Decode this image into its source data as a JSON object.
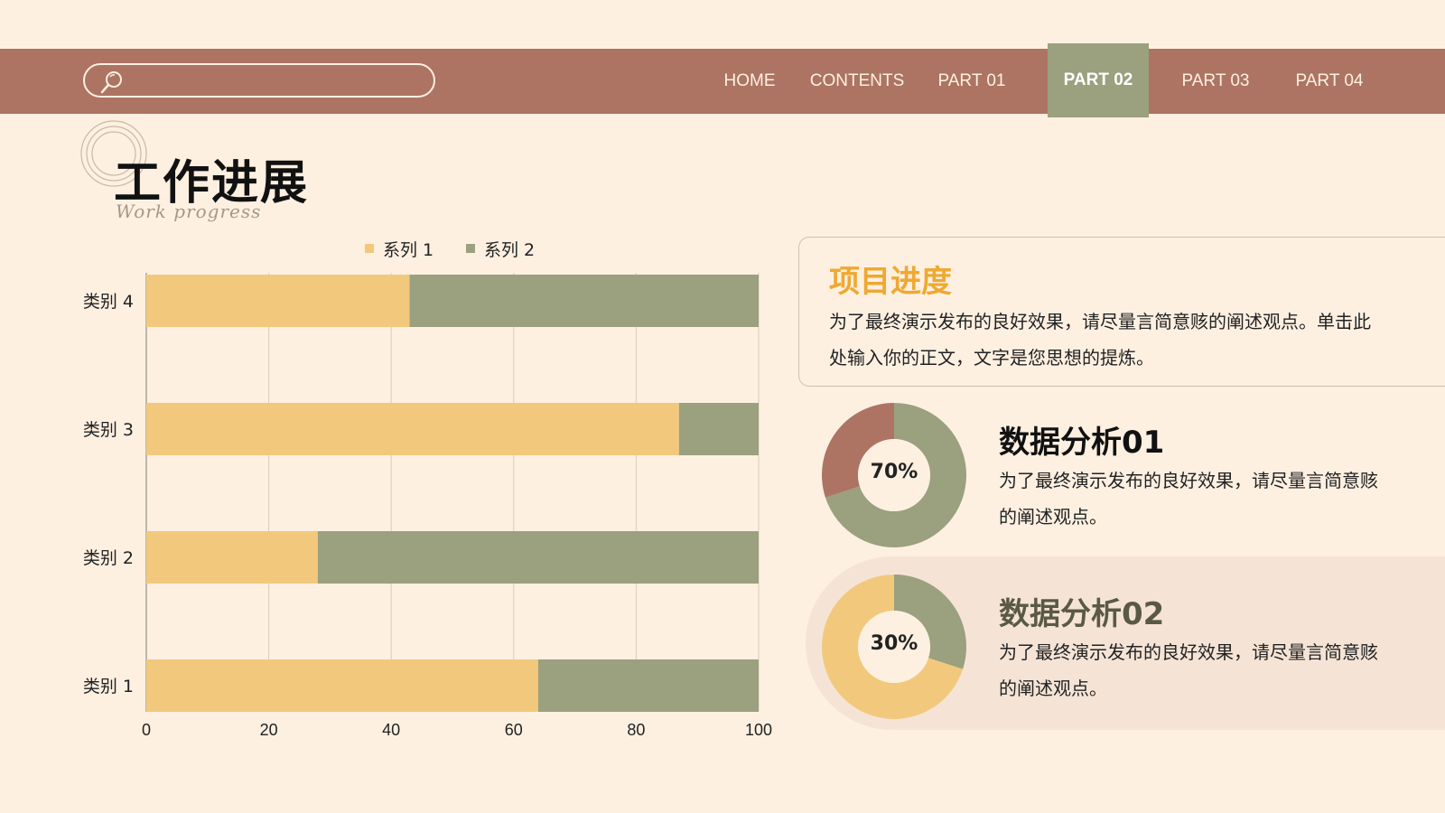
{
  "nav": {
    "search_placeholder": "",
    "items": [
      {
        "label": "HOME",
        "active": false
      },
      {
        "label": "CONTENTS",
        "active": false
      },
      {
        "label": "PART 01",
        "active": false
      },
      {
        "label": "PART 02",
        "active": true
      },
      {
        "label": "PART 03",
        "active": false
      },
      {
        "label": "PART 04",
        "active": false
      }
    ]
  },
  "page": {
    "title": "工作进展",
    "subtitle": "Work progress"
  },
  "colors": {
    "background": "#fdf0e1",
    "nav": "#ad7463",
    "nav_active": "#9ba07e",
    "series1": "#f2c97c",
    "series2": "#9ba07e",
    "accent_orange": "#f0a830",
    "donut_terracotta": "#ad7463"
  },
  "chart_data": {
    "type": "bar",
    "orientation": "horizontal",
    "stacked": true,
    "categories": [
      "类别 1",
      "类别 2",
      "类别 3",
      "类别 4"
    ],
    "series": [
      {
        "name": "系列 1",
        "values": [
          64,
          28,
          87,
          43
        ]
      },
      {
        "name": "系列 2",
        "values": [
          36,
          72,
          13,
          57
        ]
      }
    ],
    "xlim": [
      0,
      100
    ],
    "xticks": [
      "0",
      "20",
      "40",
      "60",
      "80",
      "100"
    ],
    "grid": true,
    "legend": "top"
  },
  "info_card": {
    "title": "项目进度",
    "body": "为了最终演示发布的良好效果，请尽量言简意赅的阐述观点。单击此处输入你的正文，文字是您思想的提炼。"
  },
  "analysis": [
    {
      "title": "数据分析01",
      "body": "为了最终演示发布的良好效果，请尽量言简意赅的阐述观点。",
      "donut_label": "70%",
      "donut_value": 0.7
    },
    {
      "title": "数据分析02",
      "body": "为了最终演示发布的良好效果，请尽量言简意赅的阐述观点。",
      "donut_label": "30%",
      "donut_value": 0.3
    }
  ]
}
